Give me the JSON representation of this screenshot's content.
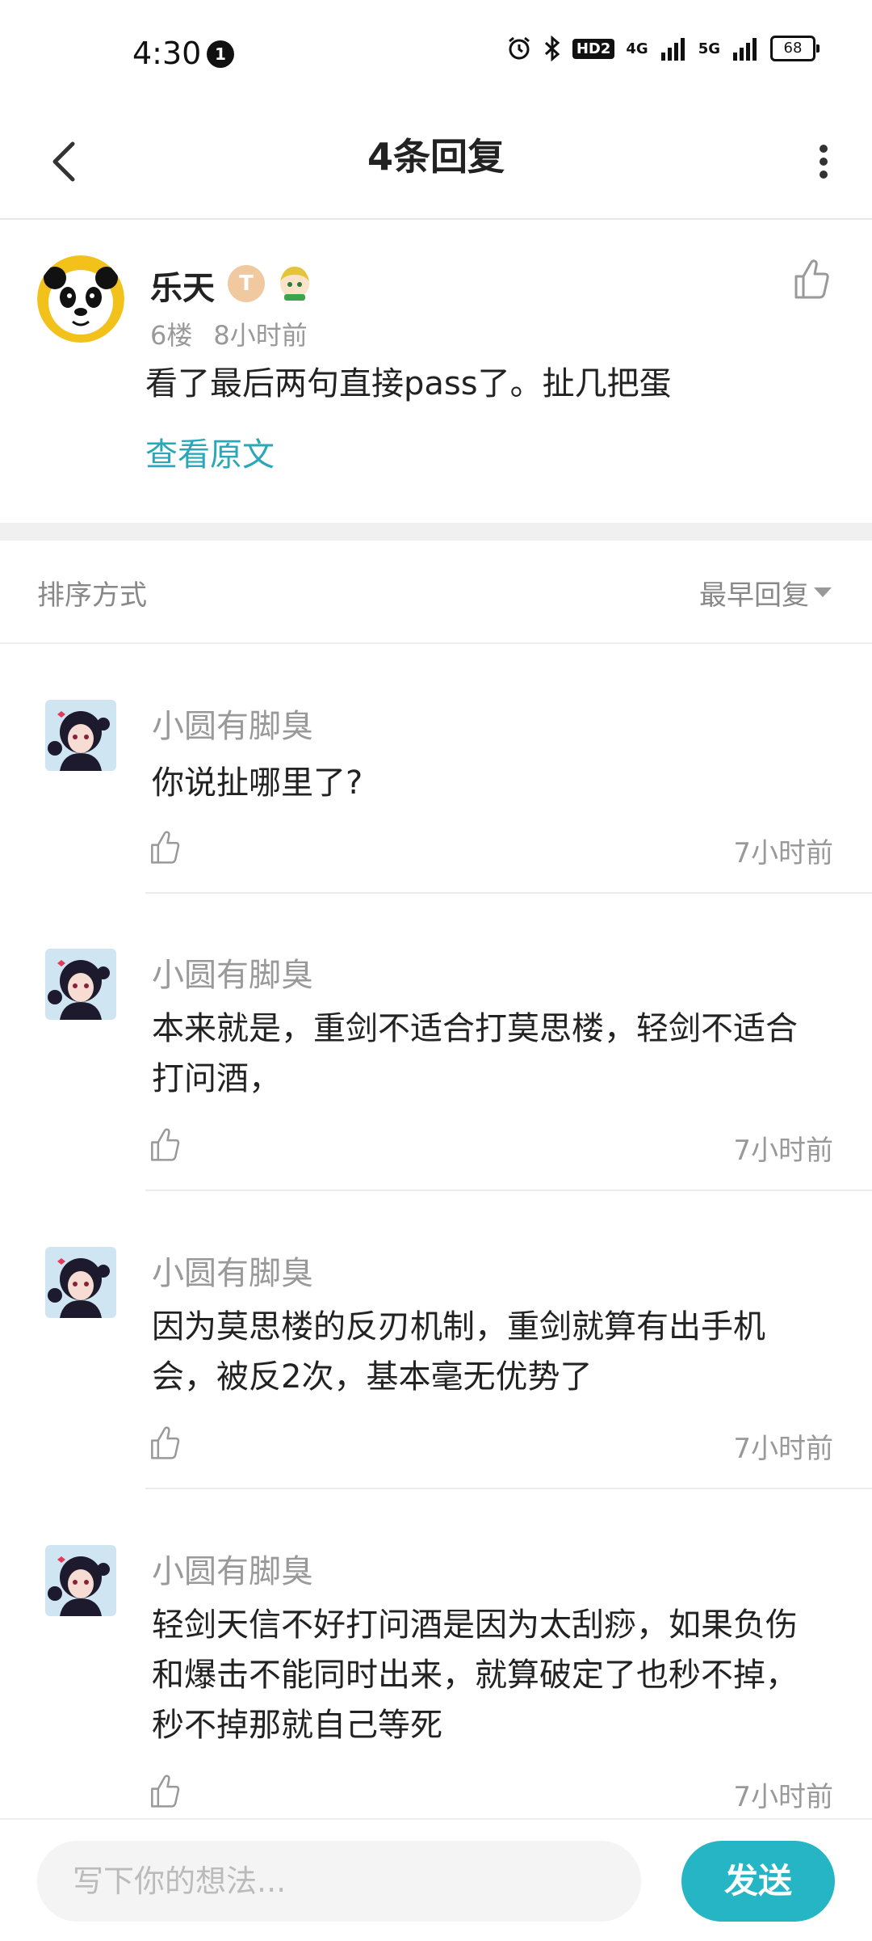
{
  "status_bar": {
    "time": "4:30",
    "notification_count": "1",
    "hd_label": "HD2",
    "network_1": "4G",
    "network_2": "5G",
    "battery": "68"
  },
  "header": {
    "title": "4条回复"
  },
  "original_post": {
    "author": "乐天",
    "badge_letter": "T",
    "floor": "6楼",
    "time": "8小时前",
    "text": "看了最后两句直接pass了。扯几把蛋",
    "view_original_label": "查看原文"
  },
  "sort": {
    "label": "排序方式",
    "value": "最早回复"
  },
  "replies": [
    {
      "author": "小圆有脚臭",
      "lines": [
        "你说扯哪里了?"
      ],
      "time": "7小时前"
    },
    {
      "author": "小圆有脚臭",
      "lines": [
        "本来就是，重剑不适合打莫思楼，轻剑不适合",
        "打问酒，"
      ],
      "time": "7小时前"
    },
    {
      "author": "小圆有脚臭",
      "lines": [
        "因为莫思楼的反刃机制，重剑就算有出手机",
        "会，被反2次，基本毫无优势了"
      ],
      "time": "7小时前"
    },
    {
      "author": "小圆有脚臭",
      "lines": [
        "轻剑天信不好打问酒是因为太刮痧，如果负伤",
        "和爆击不能同时出来，就算破定了也秒不掉，",
        "秒不掉那就自己等死"
      ],
      "time": "7小时前"
    }
  ],
  "composer": {
    "placeholder": "写下你的想法...",
    "send_label": "发送"
  },
  "colors": {
    "accent": "#26b5c4",
    "link": "#2aa7b8"
  }
}
